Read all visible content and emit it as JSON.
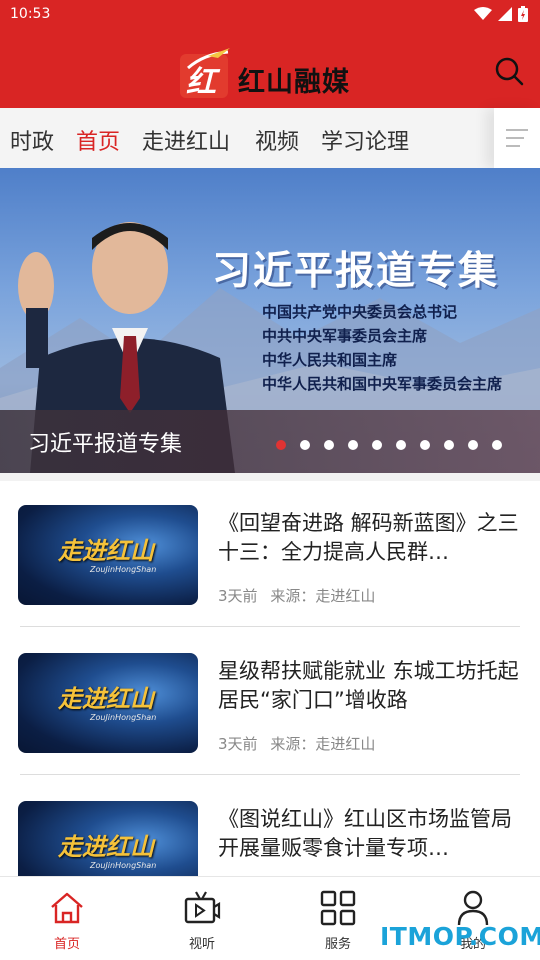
{
  "status_bar": {
    "time": "10:53"
  },
  "header": {
    "app_name": "红山融媒",
    "logo_text": "红"
  },
  "tabs": [
    {
      "label": "时政",
      "active": false
    },
    {
      "label": "首页",
      "active": true
    },
    {
      "label": "走进红山",
      "active": false
    },
    {
      "label": "视频",
      "active": false
    },
    {
      "label": "学习论理",
      "active": false
    }
  ],
  "banner": {
    "heading": "习近平报道专集",
    "subtitles": [
      "中国共产党中央委员会总书记",
      "中共中央军事委员会主席",
      "中华人民共和国主席",
      "中华人民共和国中央军事委员会主席"
    ],
    "caption": "习近平报道专集",
    "page_count": 10,
    "active_page": 1
  },
  "news": [
    {
      "title": "《回望奋进路 解码新蓝图》之三十三：全力提高人民群…",
      "time": "3天前",
      "source": "来源：走进红山",
      "thumb_title": "走进红山",
      "thumb_sub": "ZouJinHongShan"
    },
    {
      "title": "星级帮扶赋能就业 东城工坊托起居民“家门口”增收路",
      "time": "3天前",
      "source": "来源：走进红山",
      "thumb_title": "走进红山",
      "thumb_sub": "ZouJinHongShan"
    },
    {
      "title": "《图说红山》红山区市场监管局开展量贩零食计量专项…",
      "time": "",
      "source": "",
      "thumb_title": "走进红山",
      "thumb_sub": "ZouJinHongShan"
    }
  ],
  "bottom_nav": [
    {
      "label": "首页",
      "icon": "home-icon",
      "active": true
    },
    {
      "label": "视听",
      "icon": "video-tv-icon",
      "active": false
    },
    {
      "label": "服务",
      "icon": "grid-icon",
      "active": false
    },
    {
      "label": "我的",
      "icon": "user-icon",
      "active": false
    }
  ],
  "watermark": "ITMOP.COM",
  "colors": {
    "brand_red": "#d92524",
    "watermark_blue": "#1ba3d9"
  }
}
